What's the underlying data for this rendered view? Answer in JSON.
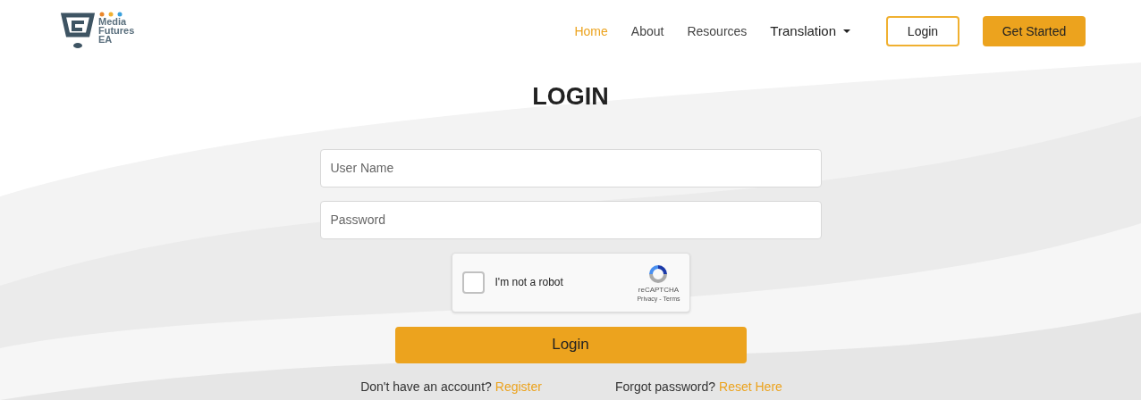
{
  "logo": {
    "lines": [
      "Media",
      "Futures",
      "EA"
    ]
  },
  "nav": [
    {
      "label": "Home",
      "selected": true
    },
    {
      "label": "About",
      "selected": false
    },
    {
      "label": "Resources",
      "selected": false
    },
    {
      "label": "Translation",
      "selected": false,
      "kind": "dropdown"
    }
  ],
  "header_buttons": [
    {
      "label": "Login",
      "kind": "outline"
    },
    {
      "label": "Get Started",
      "kind": "filled"
    }
  ],
  "title": "LOGIN",
  "fields": [
    {
      "placeholder": "User Name"
    },
    {
      "placeholder": "Password"
    }
  ],
  "captcha": {
    "label": "I'm not a robot",
    "checked": false,
    "brand": "reCAPTCHA",
    "links": "Privacy - Terms"
  },
  "submit": "Login",
  "footer_links": [
    {
      "text": "Don't have an account?",
      "link": "Register"
    },
    {
      "text": "Forgot password?",
      "link": "Reset Here"
    }
  ]
}
